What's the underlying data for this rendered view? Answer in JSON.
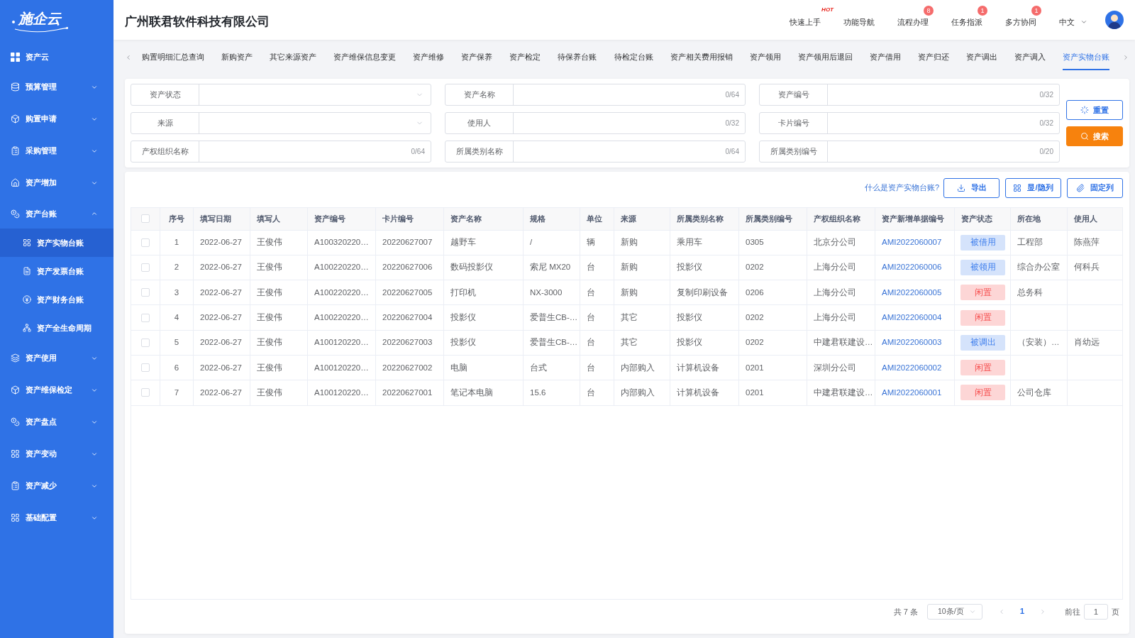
{
  "sidebar": {
    "logo": "施企云",
    "items": [
      {
        "label": "资产云",
        "kind": "link"
      },
      {
        "label": "预算管理",
        "kind": "group",
        "expanded": false
      },
      {
        "label": "购置申请",
        "kind": "group",
        "expanded": false
      },
      {
        "label": "采购管理",
        "kind": "group",
        "expanded": false
      },
      {
        "label": "资产增加",
        "kind": "group",
        "expanded": false
      },
      {
        "label": "资产台账",
        "kind": "group",
        "expanded": true,
        "children": [
          {
            "label": "资产实物台账",
            "selected": true
          },
          {
            "label": "资产发票台账",
            "selected": false
          },
          {
            "label": "资产财务台账",
            "selected": false
          },
          {
            "label": "资产全生命周期",
            "selected": false
          }
        ]
      },
      {
        "label": "资产使用",
        "kind": "group",
        "expanded": false
      },
      {
        "label": "资产维保检定",
        "kind": "group",
        "expanded": false
      },
      {
        "label": "资产盘点",
        "kind": "group",
        "expanded": false
      },
      {
        "label": "资产变动",
        "kind": "group",
        "expanded": false
      },
      {
        "label": "资产减少",
        "kind": "group",
        "expanded": false
      },
      {
        "label": "基础配置",
        "kind": "group",
        "expanded": false
      }
    ]
  },
  "header": {
    "company": "广州联君软件科技有限公司",
    "actions": [
      {
        "label": "快速上手",
        "badge": {
          "kind": "hot",
          "text": "HOT"
        }
      },
      {
        "label": "功能导航"
      },
      {
        "label": "流程办理",
        "badge": {
          "kind": "count",
          "text": "8"
        }
      },
      {
        "label": "任务指派",
        "badge": {
          "kind": "count",
          "text": "1"
        }
      },
      {
        "label": "多方协同",
        "badge": {
          "kind": "count",
          "text": "1"
        }
      }
    ],
    "language": "中文"
  },
  "tabs": [
    {
      "label": "购置明细汇总查询",
      "selected": false
    },
    {
      "label": "新购资产",
      "selected": false
    },
    {
      "label": "其它来源资产",
      "selected": false
    },
    {
      "label": "资产维保信息变更",
      "selected": false
    },
    {
      "label": "资产维修",
      "selected": false
    },
    {
      "label": "资产保养",
      "selected": false
    },
    {
      "label": "资产检定",
      "selected": false
    },
    {
      "label": "待保养台账",
      "selected": false
    },
    {
      "label": "待检定台账",
      "selected": false
    },
    {
      "label": "资产相关费用报销",
      "selected": false
    },
    {
      "label": "资产领用",
      "selected": false
    },
    {
      "label": "资产领用后退回",
      "selected": false
    },
    {
      "label": "资产借用",
      "selected": false
    },
    {
      "label": "资产归还",
      "selected": false
    },
    {
      "label": "资产调出",
      "selected": false
    },
    {
      "label": "资产调入",
      "selected": false
    },
    {
      "label": "资产实物台账",
      "selected": true
    }
  ],
  "filters": {
    "fields": [
      {
        "label": "资产状态",
        "kind": "select"
      },
      {
        "label": "资产名称",
        "kind": "input",
        "counter": "0/64"
      },
      {
        "label": "资产编号",
        "kind": "input",
        "counter": "0/32"
      },
      {
        "label": "来源",
        "kind": "select"
      },
      {
        "label": "使用人",
        "kind": "input",
        "counter": "0/32"
      },
      {
        "label": "卡片编号",
        "kind": "input",
        "counter": "0/32"
      },
      {
        "label": "产权组织名称",
        "kind": "input",
        "counter": "0/64"
      },
      {
        "label": "所属类别名称",
        "kind": "input",
        "counter": "0/64"
      },
      {
        "label": "所属类别编号",
        "kind": "input",
        "counter": "0/20"
      }
    ],
    "buttons": [
      {
        "label": "重置",
        "kind": "reset"
      },
      {
        "label": "搜索",
        "kind": "search"
      }
    ]
  },
  "toolbar": {
    "help_link": "什么是资产实物台账?",
    "buttons": [
      {
        "label": "导出",
        "kind": "export"
      },
      {
        "label": "显/隐列",
        "kind": "columns"
      },
      {
        "label": "固定列",
        "kind": "pin"
      }
    ]
  },
  "table": {
    "all_checked": false,
    "columns": [
      "序号",
      "填写日期",
      "填写人",
      "资产编号",
      "卡片编号",
      "资产名称",
      "规格",
      "单位",
      "来源",
      "所属类别名称",
      "所属类别编号",
      "产权组织名称",
      "资产新增单据编号",
      "资产状态",
      "所在地",
      "使用人"
    ],
    "rows": [
      {
        "checked": false,
        "index": "1",
        "date": "2022-06-27",
        "filler": "王俊伟",
        "asset_no": "A100320220…",
        "card_no": "20220627007",
        "name": "越野车",
        "spec": "/",
        "unit": "辆",
        "source": "新购",
        "category_name": "乘用车",
        "category_no": "0305",
        "owner_org": "北京分公司",
        "doc_no": "AMI2022060007",
        "status": {
          "label": "被借用",
          "color": "#d5e3fb"
        },
        "location": "工程部",
        "user": "陈燕萍"
      },
      {
        "checked": false,
        "index": "2",
        "date": "2022-06-27",
        "filler": "王俊伟",
        "asset_no": "A100220220…",
        "card_no": "20220627006",
        "name": "数码投影仪",
        "spec": "索尼 MX20",
        "unit": "台",
        "source": "新购",
        "category_name": "投影仪",
        "category_no": "0202",
        "owner_org": "上海分公司",
        "doc_no": "AMI2022060006",
        "status": {
          "label": "被领用",
          "color": "#d5e3fb"
        },
        "location": "综合办公室",
        "user": "何科兵"
      },
      {
        "checked": false,
        "index": "3",
        "date": "2022-06-27",
        "filler": "王俊伟",
        "asset_no": "A100220220…",
        "card_no": "20220627005",
        "name": "打印机",
        "spec": "NX-3000",
        "unit": "台",
        "source": "新购",
        "category_name": "复制印刷设备",
        "category_no": "0206",
        "owner_org": "上海分公司",
        "doc_no": "AMI2022060005",
        "status": {
          "label": "闲置",
          "color": "#fdd6d6"
        },
        "location": "总务科"
      },
      {
        "checked": false,
        "index": "4",
        "date": "2022-06-27",
        "filler": "王俊伟",
        "asset_no": "A100220220…",
        "card_no": "20220627004",
        "name": "投影仪",
        "spec": "爱普生CB-…",
        "unit": "台",
        "source": "其它",
        "category_name": "投影仪",
        "category_no": "0202",
        "owner_org": "上海分公司",
        "doc_no": "AMI2022060004",
        "status": {
          "label": "闲置",
          "color": "#fdd6d6"
        }
      },
      {
        "checked": false,
        "index": "5",
        "date": "2022-06-27",
        "filler": "王俊伟",
        "asset_no": "A100120220…",
        "card_no": "20220627003",
        "name": "投影仪",
        "spec": "爱普生CB-…",
        "unit": "台",
        "source": "其它",
        "category_name": "投影仪",
        "category_no": "0202",
        "owner_org": "中建君联建设…",
        "doc_no": "AMI2022060003",
        "status": {
          "label": "被调出",
          "color": "#d5e3fb"
        },
        "location": "（安装）…",
        "user": "肖幼远"
      },
      {
        "checked": false,
        "index": "6",
        "date": "2022-06-27",
        "filler": "王俊伟",
        "asset_no": "A100120220…",
        "card_no": "20220627002",
        "name": "电脑",
        "spec": "台式",
        "unit": "台",
        "source": "内部购入",
        "category_name": "计算机设备",
        "category_no": "0201",
        "owner_org": "深圳分公司",
        "doc_no": "AMI2022060002",
        "status": {
          "label": "闲置",
          "color": "#fdd6d6"
        }
      },
      {
        "checked": false,
        "index": "7",
        "date": "2022-06-27",
        "filler": "王俊伟",
        "asset_no": "A100120220…",
        "card_no": "20220627001",
        "name": "笔记本电脑",
        "spec": "15.6",
        "unit": "台",
        "source": "内部购入",
        "category_name": "计算机设备",
        "category_no": "0201",
        "owner_org": "中建君联建设…",
        "doc_no": "AMI2022060001",
        "status": {
          "label": "闲置",
          "color": "#fdd6d6"
        },
        "location": "公司仓库"
      }
    ]
  },
  "pagination": {
    "total": "共 7 条",
    "page_size": "10条/页",
    "pages": [
      {
        "label": "1",
        "selected": true
      }
    ],
    "goto_label": "前往",
    "goto_value": "1",
    "goto_suffix": "页"
  }
}
